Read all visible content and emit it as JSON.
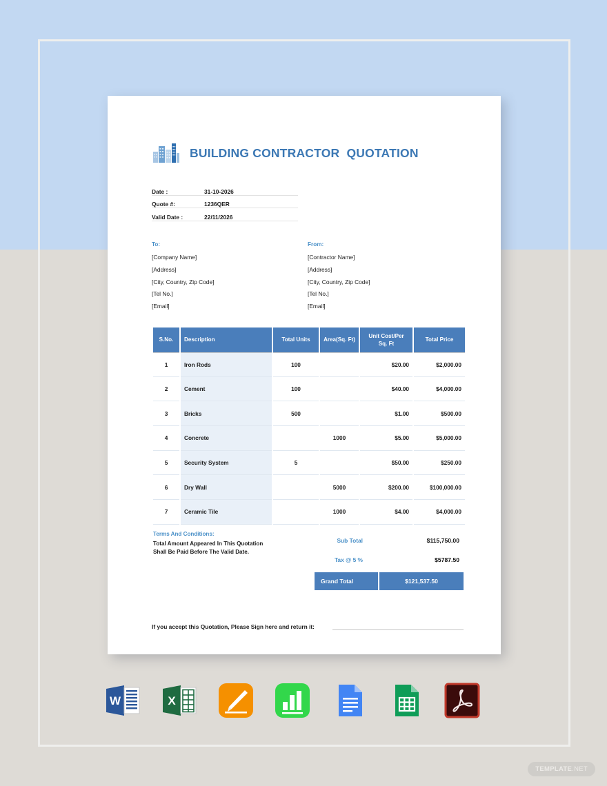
{
  "document": {
    "title": "BUILDING CONTRACTOR  QUOTATION",
    "logo_icon": "city-buildings-icon",
    "meta": [
      {
        "label": "Date :",
        "value": "31-10-2026"
      },
      {
        "label": "Quote #:",
        "value": "1236QER"
      },
      {
        "label": "Valid Date :",
        "value": "22/11/2026"
      }
    ],
    "to": {
      "heading": "To:",
      "lines": [
        "[Company Name]",
        "[Address]",
        "[City, Country, Zip Code]",
        "[Tel No.]",
        "[Email]"
      ]
    },
    "from": {
      "heading": "From:",
      "lines": [
        "[Contractor Name]",
        "[Address]",
        "[City, Country, Zip Code]",
        "[Tel No.]",
        "[Email]"
      ]
    },
    "table": {
      "headers": [
        "S.No.",
        "Description",
        "Total Units",
        "Area(Sq. Ft)",
        "Unit Cost/Per Sq. Ft",
        "Total Price"
      ],
      "rows": [
        {
          "sno": "1",
          "description": "Iron Rods",
          "units": "100",
          "area": "",
          "cost": "$20.00",
          "price": "$2,000.00"
        },
        {
          "sno": "2",
          "description": "Cement",
          "units": "100",
          "area": "",
          "cost": "$40.00",
          "price": "$4,000.00"
        },
        {
          "sno": "3",
          "description": "Bricks",
          "units": "500",
          "area": "",
          "cost": "$1.00",
          "price": "$500.00"
        },
        {
          "sno": "4",
          "description": "Concrete",
          "units": "",
          "area": "1000",
          "cost": "$5.00",
          "price": "$5,000.00"
        },
        {
          "sno": "5",
          "description": "Security System",
          "units": "5",
          "area": "",
          "cost": "$50.00",
          "price": "$250.00"
        },
        {
          "sno": "6",
          "description": "Dry Wall",
          "units": "",
          "area": "5000",
          "cost": "$200.00",
          "price": "$100,000.00"
        },
        {
          "sno": "7",
          "description": "Ceramic Tile",
          "units": "",
          "area": "1000",
          "cost": "$4.00",
          "price": "$4,000.00"
        }
      ]
    },
    "totals": {
      "sub_total_label": "Sub Total",
      "sub_total_value": "$115,750.00",
      "tax_label": "Tax  @ 5 %",
      "tax_value": "$5787.50",
      "grand_total_label": "Grand Total",
      "grand_total_value": "$121,537.50"
    },
    "terms": {
      "heading": "Terms And Conditions:",
      "lines": [
        "Total Amount Appeared In This Quotation",
        "Shall Be Paid Before The Valid Date."
      ]
    },
    "signature": {
      "text": "If you accept this Quotation, Please Sign here and return it:"
    }
  },
  "apps": [
    {
      "name": "microsoft-word-icon",
      "label": "W"
    },
    {
      "name": "microsoft-excel-icon",
      "label": "X"
    },
    {
      "name": "apple-pages-icon",
      "label": ""
    },
    {
      "name": "apple-numbers-icon",
      "label": ""
    },
    {
      "name": "google-docs-icon",
      "label": ""
    },
    {
      "name": "google-sheets-icon",
      "label": ""
    },
    {
      "name": "adobe-pdf-icon",
      "label": ""
    }
  ],
  "watermark": {
    "brand": "TEMPLATE",
    "suffix": ".NET"
  },
  "colors": {
    "header_blue": "#4a7ebb",
    "accent_blue": "#4a90c8",
    "title_blue": "#3c78b4",
    "desc_tint": "#e9f0f8",
    "backdrop_top": "#c2d8f2",
    "backdrop_bottom": "#dedbd6"
  }
}
